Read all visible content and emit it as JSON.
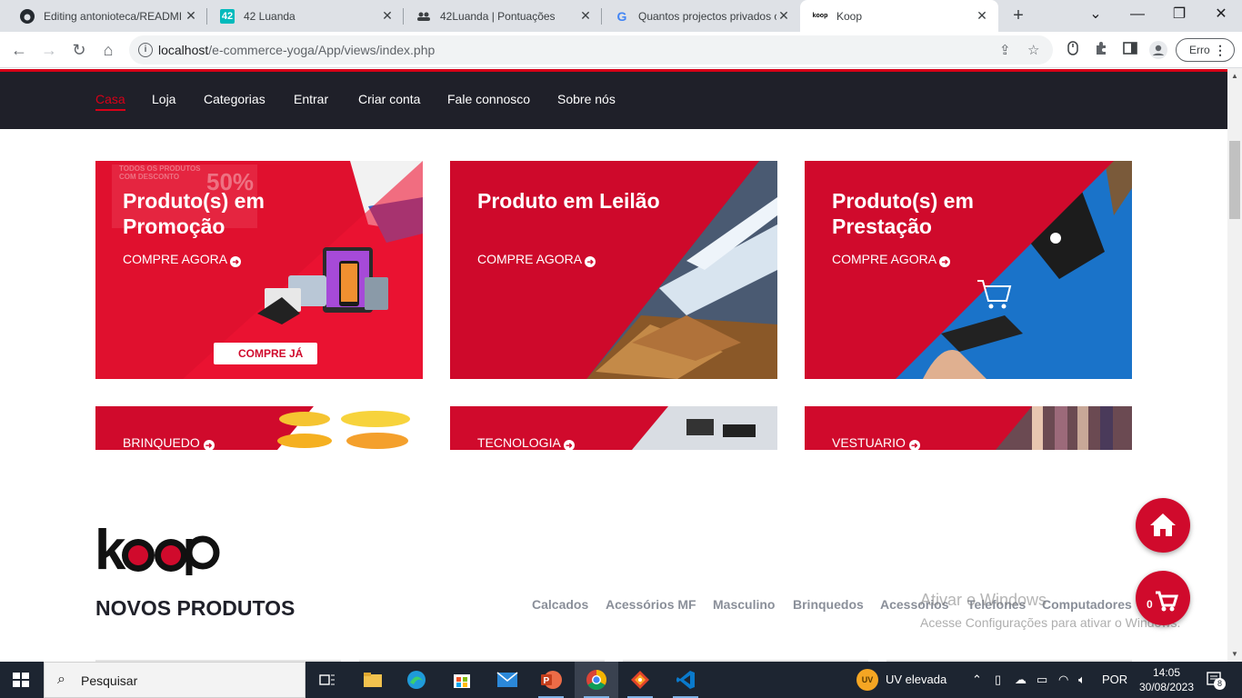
{
  "browser": {
    "tabs": [
      {
        "title": "Editing antonioteca/READMI",
        "icon": "github-icon"
      },
      {
        "title": "42 Luanda",
        "icon": "42-icon"
      },
      {
        "title": "42Luanda | Pontuações",
        "icon": "people-icon"
      },
      {
        "title": "Quantos projectos privados c",
        "icon": "google-icon"
      },
      {
        "title": "Koop",
        "icon": "koop-icon"
      }
    ],
    "url_host": "localhost",
    "url_path": "/e-commerce-yoga/App/views/index.php",
    "error_label": "Erro"
  },
  "nav": {
    "items": [
      "Casa",
      "Loja",
      "Categorias",
      "Entrar",
      "Criar conta",
      "Fale connosco",
      "Sobre nós"
    ],
    "active": "Casa"
  },
  "banners": {
    "big": [
      {
        "title": "Produto(s) em Promoção",
        "cta": "COMPRE AGORA",
        "extra1": "TODOS OS PRODUTOS COM DESCONTO",
        "extra2": "50%",
        "extra3": "COMPRE JÁ"
      },
      {
        "title": "Produto em Leilão",
        "cta": "COMPRE AGORA"
      },
      {
        "title": "Produto(s) em Prestação",
        "cta": "COMPRE AGORA"
      }
    ],
    "small": [
      {
        "label": "BRINQUEDO"
      },
      {
        "label": "TECNOLOGIA"
      },
      {
        "label": "VESTUARIO"
      }
    ]
  },
  "section": {
    "logo_text": "KOOP",
    "title": "NOVOS PRODUTOS",
    "categories": [
      "Calcados",
      "Acessórios MF",
      "Masculino",
      "Brinquedos",
      "Acessorios",
      "Telefones",
      "Computadores"
    ]
  },
  "cart_count": "0",
  "watermark": {
    "line1": "Ativar o Windows",
    "line2": "Acesse Configurações para ativar o Windows."
  },
  "taskbar": {
    "search": "Pesquisar",
    "weather": "UV elevada",
    "lang": "POR",
    "time": "14:05",
    "date": "30/08/2023",
    "notifications": "8"
  },
  "colors": {
    "brand_red": "#d00a2c",
    "nav_dark": "#1f2029"
  }
}
